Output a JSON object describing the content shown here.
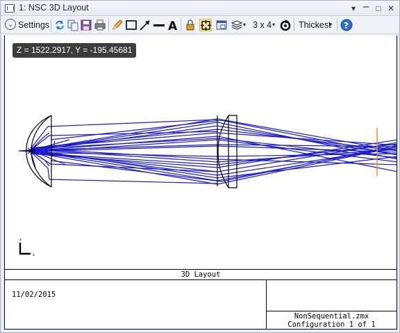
{
  "window": {
    "title": "1: NSC 3D Layout",
    "controls": {
      "minimize": "▾",
      "maximize": "□",
      "close": "✕"
    }
  },
  "toolbar": {
    "settings_label": "Settings",
    "grid_label": "3 x 4",
    "line_thickness_label": "Thickest",
    "icons": [
      "settings-chevron-icon",
      "refresh-icon",
      "copy-icon",
      "save-icon",
      "print-icon",
      "pencil-icon",
      "rectangle-icon",
      "arrow-icon",
      "line-icon",
      "text-icon",
      "lock-icon",
      "fit-icon",
      "window-icon",
      "layers-icon",
      "rotate-icon",
      "help-icon"
    ]
  },
  "plot": {
    "cursor_readout": "Z = 1522.2917, Y = -195.45681",
    "axis_x_label": "x",
    "axis_z_label": "z",
    "ray_color": "#1a1acc",
    "detector_color": "#e8913a"
  },
  "info_box": {
    "title": "3D Layout",
    "date": "11/02/2015",
    "file_name": "NonSequential.zmx",
    "configuration": "Configuration 1 of 1"
  }
}
